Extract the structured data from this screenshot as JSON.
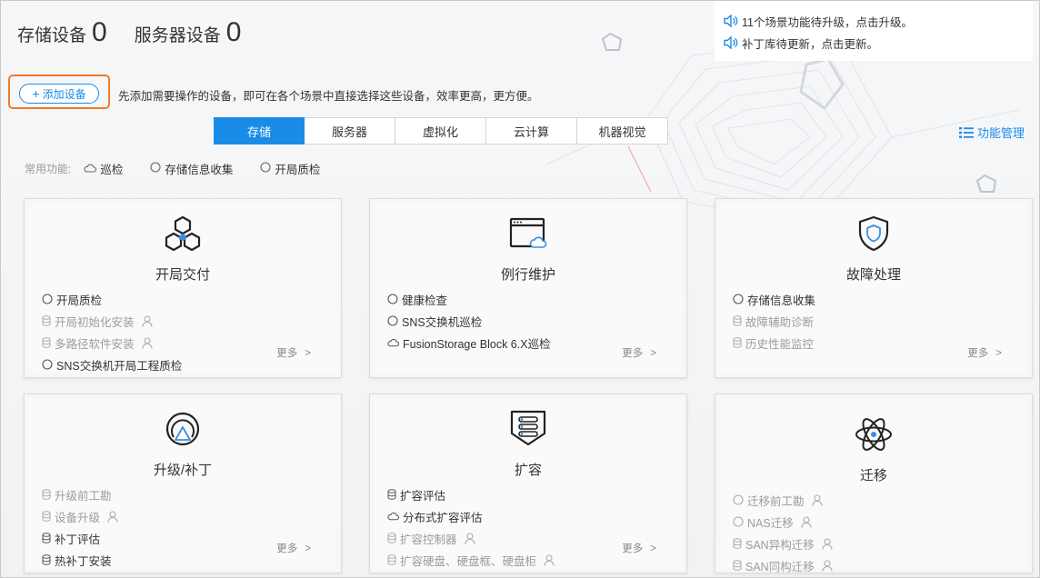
{
  "counts": {
    "storage_label": "存储设备",
    "storage_value": "0",
    "server_label": "服务器设备",
    "server_value": "0"
  },
  "notices": [
    {
      "icon": "speaker-icon",
      "text": "11个场景功能待升级，点击升级。"
    },
    {
      "icon": "speaker-icon",
      "text": "补丁库待更新，点击更新。"
    }
  ],
  "add_device": {
    "label": "添加设备",
    "hint": "先添加需要操作的设备，即可在各个场景中直接选择这些设备，效率更高，更方便。"
  },
  "tabs": [
    "存储",
    "服务器",
    "虚拟化",
    "云计算",
    "机器视觉"
  ],
  "active_tab": "存储",
  "function_manage": "功能管理",
  "common": {
    "label": "常用功能:",
    "items": [
      {
        "icon": "cloud-icon",
        "label": "巡检"
      },
      {
        "icon": "circle-icon",
        "label": "存储信息收集"
      },
      {
        "icon": "circle-icon",
        "label": "开局质检"
      }
    ]
  },
  "cards": [
    {
      "title": "开局交付",
      "icon": "hexagon-cluster-icon",
      "more": "更多",
      "items": [
        {
          "label": "开局质检",
          "icon": "circle-icon",
          "enabled": true,
          "user": false
        },
        {
          "label": "开局初始化安装",
          "icon": "database-icon",
          "enabled": false,
          "user": true
        },
        {
          "label": "多路径软件安装",
          "icon": "database-icon",
          "enabled": false,
          "user": true
        },
        {
          "label": "SNS交换机开局工程质检",
          "icon": "circle-icon",
          "enabled": true,
          "user": false
        }
      ]
    },
    {
      "title": "例行维护",
      "icon": "browser-window-icon",
      "more": "更多",
      "items": [
        {
          "label": "健康检查",
          "icon": "circle-icon",
          "enabled": true,
          "user": false
        },
        {
          "label": "SNS交换机巡检",
          "icon": "circle-icon",
          "enabled": true,
          "user": false
        },
        {
          "label": "FusionStorage Block 6.X巡检",
          "icon": "cloud-icon",
          "enabled": true,
          "user": false
        }
      ]
    },
    {
      "title": "故障处理",
      "icon": "shield-icon",
      "more": "更多",
      "items": [
        {
          "label": "存储信息收集",
          "icon": "circle-icon",
          "enabled": true,
          "user": false
        },
        {
          "label": "故障辅助诊断",
          "icon": "database-icon",
          "enabled": false,
          "user": false
        },
        {
          "label": "历史性能监控",
          "icon": "database-icon",
          "enabled": false,
          "user": false
        }
      ]
    },
    {
      "title": "升级/补丁",
      "icon": "upgrade-icon",
      "more": "更多",
      "items": [
        {
          "label": "升级前工勘",
          "icon": "database-icon",
          "enabled": false,
          "user": false
        },
        {
          "label": "设备升级",
          "icon": "database-icon",
          "enabled": false,
          "user": true
        },
        {
          "label": "补丁评估",
          "icon": "database-icon",
          "enabled": true,
          "user": false
        },
        {
          "label": "热补丁安装",
          "icon": "database-icon",
          "enabled": true,
          "user": false
        }
      ]
    },
    {
      "title": "扩容",
      "icon": "expansion-shield-icon",
      "more": "更多",
      "items": [
        {
          "label": "扩容评估",
          "icon": "database-icon",
          "enabled": true,
          "user": false
        },
        {
          "label": "分布式扩容评估",
          "icon": "cloud-icon",
          "enabled": true,
          "user": false
        },
        {
          "label": "扩容控制器",
          "icon": "database-icon",
          "enabled": false,
          "user": true
        },
        {
          "label": "扩容硬盘、硬盘框、硬盘柜",
          "icon": "database-icon",
          "enabled": false,
          "user": true
        }
      ]
    },
    {
      "title": "迁移",
      "icon": "atom-icon",
      "more": "",
      "items": [
        {
          "label": "迁移前工勘",
          "icon": "circle-icon",
          "enabled": false,
          "user": true
        },
        {
          "label": "NAS迁移",
          "icon": "circle-icon",
          "enabled": false,
          "user": true
        },
        {
          "label": "SAN异构迁移",
          "icon": "database-icon",
          "enabled": false,
          "user": true
        },
        {
          "label": "SAN同构迁移",
          "icon": "database-icon",
          "enabled": false,
          "user": true
        }
      ]
    }
  ],
  "colors": {
    "accent": "#1a8ce8",
    "highlight": "#f07a2a",
    "disabled": "#9c9c9c"
  }
}
